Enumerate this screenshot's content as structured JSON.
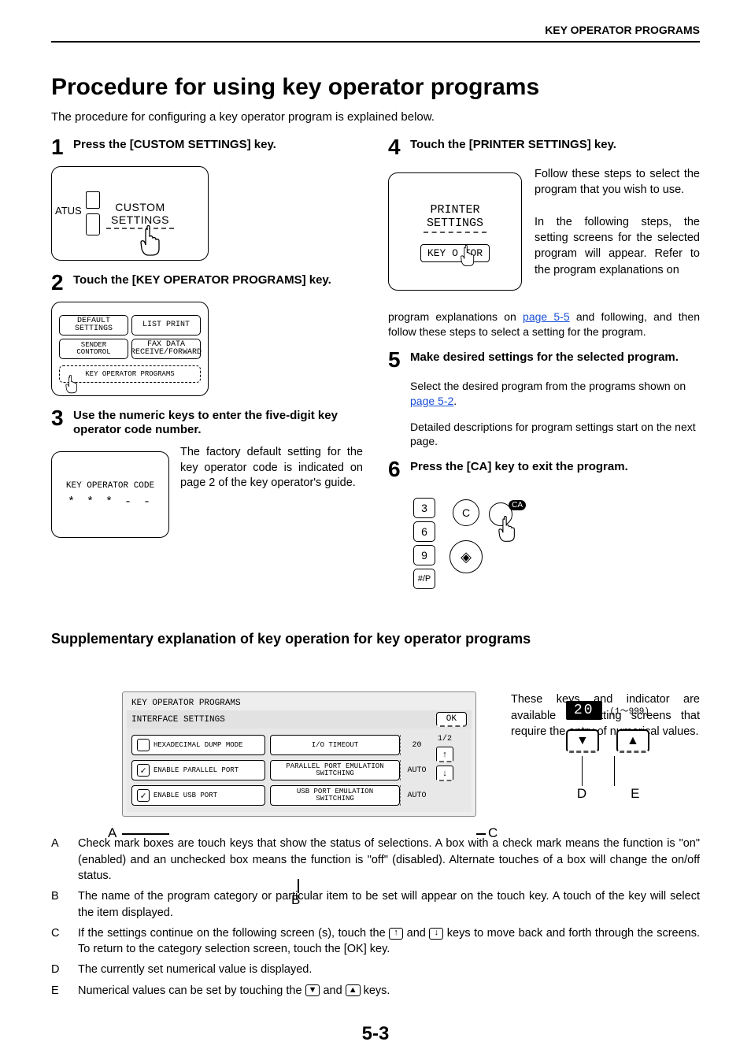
{
  "header": "KEY OPERATOR PROGRAMS",
  "title": "Procedure for using key operator programs",
  "intro": "The procedure for configuring a key operator program is explained below.",
  "steps": {
    "s1": {
      "num": "1",
      "title": "Press the [CUSTOM SETTINGS] key."
    },
    "s2": {
      "num": "2",
      "title": "Touch the [KEY OPERATOR PROGRAMS] key."
    },
    "s3": {
      "num": "3",
      "title": "Use the numeric keys to enter the five-digit key operator code number.",
      "body": "The factory default setting for the key operator code is indicated on page 2 of the key operator's guide."
    },
    "s4": {
      "num": "4",
      "title": "Touch the [PRINTER SETTINGS] key.",
      "body_pre": "Follow these steps to select the program that you wish to use.",
      "body_mid": "In the following steps, the setting screens for the selected program will appear. Refer to the program explanations on ",
      "link": "page 5-5",
      "body_post": " and following, and then follow these steps to select a setting for the program."
    },
    "s5": {
      "num": "5",
      "title": "Make desired settings for the selected program.",
      "body1": "Select the desired program from the programs shown on ",
      "link": "page 5-2",
      "body1_post": ".",
      "body2": "Detailed descriptions for program settings start on the next page."
    },
    "s6": {
      "num": "6",
      "title": "Press the [CA] key to exit the program."
    }
  },
  "fig1": {
    "custom": "CUSTOM\nSETTINGS",
    "atus": "ATUS"
  },
  "fig2": {
    "default": "DEFAULT\nSETTINGS",
    "list_print": "LIST PRINT",
    "sender": "SENDER CONTOROL",
    "fax": "FAX DATA\nRECEIVE/FORWARD",
    "key_op": "KEY OPERATOR PROGRAMS"
  },
  "fig3": {
    "label": "KEY OPERATOR CODE",
    "stars": "* * * - -"
  },
  "fig4": {
    "printer": "PRINTER\nSETTINGS",
    "key_op": "KEY O     TOR"
  },
  "fig6": {
    "keys": [
      "3",
      "6",
      "9",
      "#/P"
    ],
    "c": "C",
    "ca": "CA",
    "diamond": "◈"
  },
  "supp": {
    "title": "Supplementary explanation of key operation for key operator programs",
    "intro": "These keys and indicator are available on setting screens that require the entry of numerical values."
  },
  "panel": {
    "title": "KEY OPERATOR PROGRAMS",
    "sub": "INTERFACE SETTINGS",
    "ok": "OK",
    "opts_left": [
      "HEXADECIMAL DUMP MODE",
      "ENABLE PARALLEL PORT",
      "ENABLE USB PORT"
    ],
    "opts_mid": [
      "I/O TIMEOUT",
      "PARALLEL PORT EMULATION\nSWITCHING",
      "USB PORT EMULATION\nSWITCHING"
    ],
    "vals": [
      "20",
      "AUTO",
      "AUTO"
    ],
    "frac": "1/2"
  },
  "value_control": {
    "value": "20",
    "range": "(1～999)"
  },
  "labels": {
    "A": "A",
    "B": "B",
    "C": "C",
    "D": "D",
    "E": "E"
  },
  "defs": {
    "A": "Check mark boxes are touch keys that show the status of selections. A box with a check mark means the function is \"on\" (enabled) and an unchecked box means the function is \"off\" (disabled). Alternate touches of a box will change the on/off status.",
    "B": "The name of the program category or particular item to be set will appear on the touch key. A touch of the key will select the item displayed.",
    "C_pre": "If the settings continue on the following screen (s), touch the ",
    "C_mid": " and ",
    "C_post": " keys to move back and forth through the screens. To return to the category selection screen, touch the [OK] key.",
    "D": "The currently set numerical value is displayed.",
    "E_pre": "Numerical values can be set by touching the ",
    "E_mid": " and ",
    "E_post": " keys."
  },
  "page_num": "5-3"
}
